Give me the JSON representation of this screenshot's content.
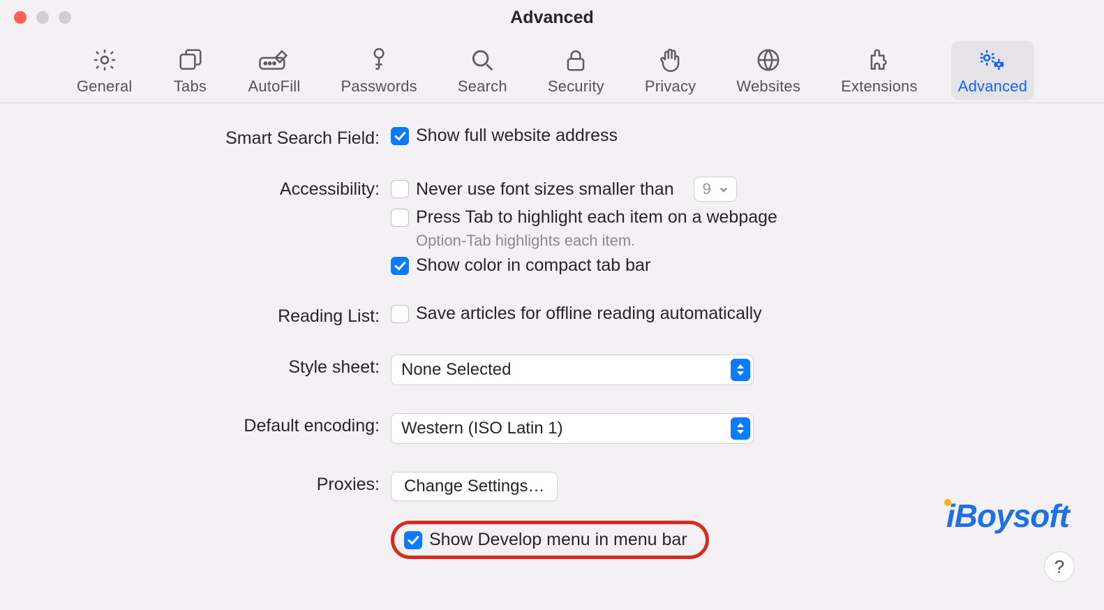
{
  "window": {
    "title": "Advanced"
  },
  "toolbar": {
    "items": [
      {
        "label": "General"
      },
      {
        "label": "Tabs"
      },
      {
        "label": "AutoFill"
      },
      {
        "label": "Passwords"
      },
      {
        "label": "Search"
      },
      {
        "label": "Security"
      },
      {
        "label": "Privacy"
      },
      {
        "label": "Websites"
      },
      {
        "label": "Extensions"
      },
      {
        "label": "Advanced"
      }
    ]
  },
  "sections": {
    "smartSearch": {
      "label": "Smart Search Field:",
      "showFullAddress": "Show full website address"
    },
    "accessibility": {
      "label": "Accessibility:",
      "neverFontSmaller": "Never use font sizes smaller than",
      "fontSizeValue": "9",
      "pressTab": "Press Tab to highlight each item on a webpage",
      "optionTabHint": "Option-Tab highlights each item.",
      "showColor": "Show color in compact tab bar"
    },
    "readingList": {
      "label": "Reading List:",
      "saveOffline": "Save articles for offline reading automatically"
    },
    "styleSheet": {
      "label": "Style sheet:",
      "value": "None Selected"
    },
    "defaultEncoding": {
      "label": "Default encoding:",
      "value": "Western (ISO Latin 1)"
    },
    "proxies": {
      "label": "Proxies:",
      "button": "Change Settings…"
    },
    "develop": {
      "label": "Show Develop menu in menu bar"
    }
  },
  "watermark": "iBoysoft",
  "help": "?"
}
